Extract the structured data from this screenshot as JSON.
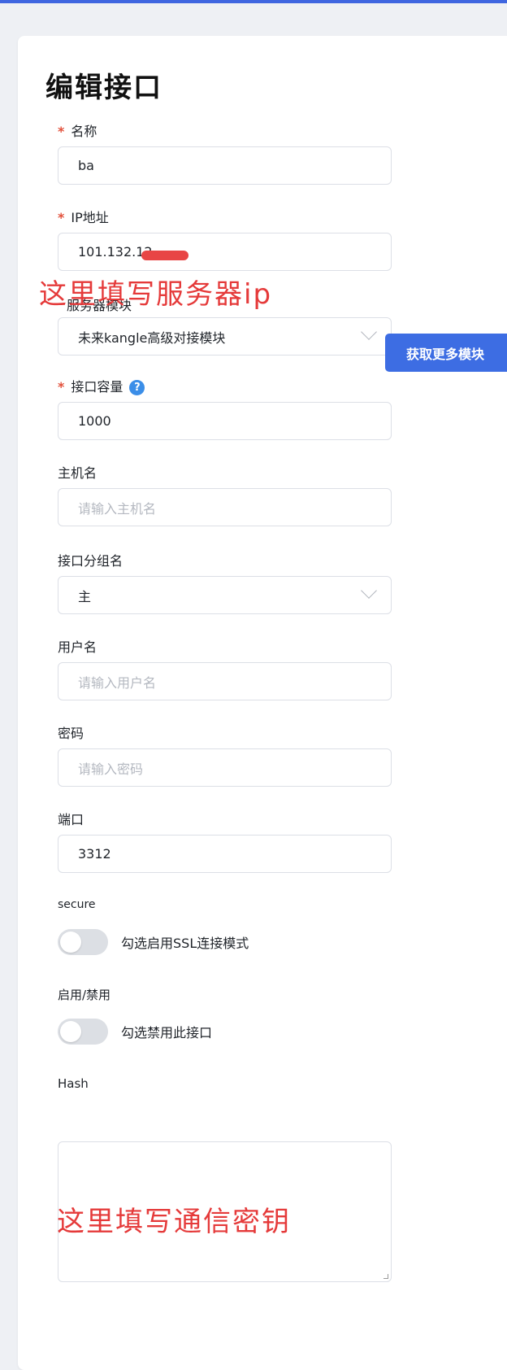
{
  "title": "编辑接口",
  "form": {
    "name": {
      "label": "名称",
      "value": "ba"
    },
    "ip": {
      "label": "IP地址",
      "value": "101.132.12"
    },
    "server_module": {
      "label": "服务器模块",
      "value": "未来kangle高级对接模块",
      "button": "获取更多模块"
    },
    "capacity": {
      "label": "接口容量",
      "help": "?",
      "value": "1000"
    },
    "hostname": {
      "label": "主机名",
      "placeholder": "请输入主机名"
    },
    "group": {
      "label": "接口分组名",
      "value": "主"
    },
    "username": {
      "label": "用户名",
      "placeholder": "请输入用户名"
    },
    "password": {
      "label": "密码",
      "placeholder": "请输入密码"
    },
    "port": {
      "label": "端口",
      "value": "3312"
    },
    "secure": {
      "label": "secure",
      "toggle_text": "勾选启用SSL连接模式",
      "enabled": false
    },
    "enable": {
      "label": "启用/禁用",
      "toggle_text": "勾选禁用此接口",
      "enabled": false
    },
    "hash": {
      "label": "Hash"
    }
  },
  "annotations": {
    "ip_note": "这里填写服务器ip",
    "hash_note": "这里填写通信密钥"
  },
  "colors": {
    "accent": "#3d6de3",
    "required": "#e2503b",
    "annotation": "#e53a3a"
  }
}
